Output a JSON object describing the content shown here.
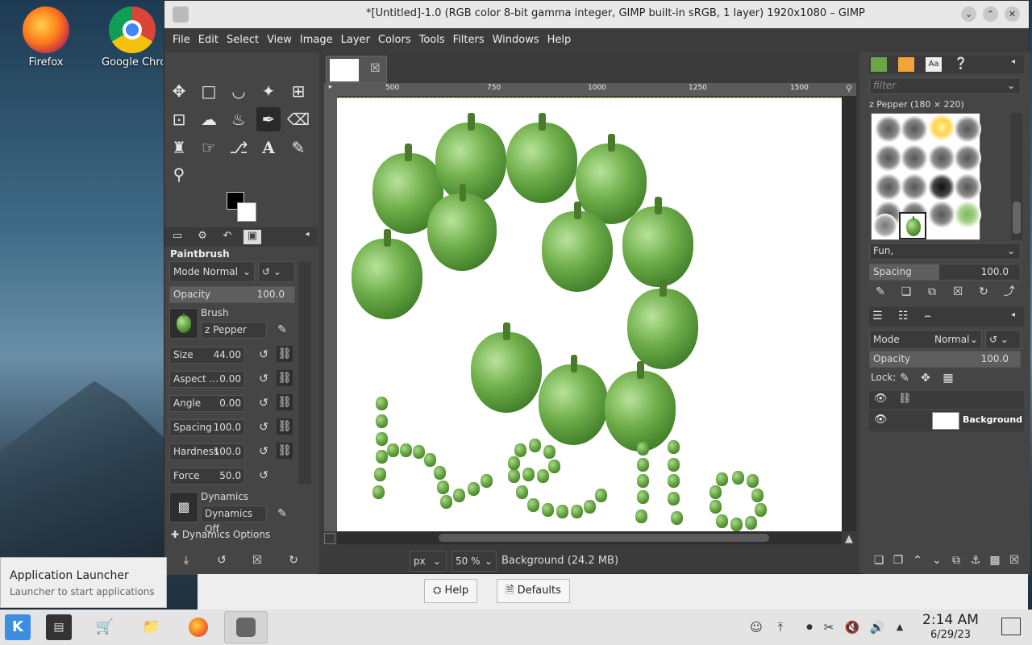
{
  "desktop": {
    "icons": [
      {
        "label": "Firefox",
        "icon": "firefox-icon"
      },
      {
        "label": "Google Chro",
        "icon": "chrome-icon"
      }
    ]
  },
  "window": {
    "title": "*[Untitled]-1.0 (RGB color 8-bit gamma integer, GIMP built-in sRGB, 1 layer) 1920x1080 – GIMP",
    "controls": [
      "minimize",
      "maximize",
      "close"
    ]
  },
  "menubar": [
    "File",
    "Edit",
    "Select",
    "View",
    "Image",
    "Layer",
    "Colors",
    "Tools",
    "Filters",
    "Windows",
    "Help"
  ],
  "tool_options": {
    "title": "Paintbrush",
    "mode_label": "Mode",
    "mode_value": "Normal",
    "opacity_label": "Opacity",
    "opacity_value": "100.0",
    "brush_label": "Brush",
    "brush_name": "z Pepper",
    "rows": [
      {
        "label": "Size",
        "value": "44.00"
      },
      {
        "label": "Aspect ...",
        "value": "0.00"
      },
      {
        "label": "Angle",
        "value": "0.00"
      },
      {
        "label": "Spacing",
        "value": "100.0"
      },
      {
        "label": "Hardness",
        "value": "100.0"
      },
      {
        "label": "Force",
        "value": "50.0"
      }
    ],
    "dynamics_label": "Dynamics",
    "dynamics_value": "Dynamics Off",
    "dynamics_options": "Dynamics Options"
  },
  "ruler": {
    "ticks": [
      "500",
      "750",
      "1000",
      "1250",
      "1500"
    ]
  },
  "statusbar": {
    "unit": "px",
    "zoom": "50 %",
    "info": "Background (24.2 MB)"
  },
  "brushes_panel": {
    "filter_placeholder": "filter",
    "selected_brush": "z Pepper (180 × 220)",
    "tag": "Fun,",
    "spacing_label": "Spacing",
    "spacing_value": "100.0"
  },
  "layers_panel": {
    "mode_label": "Mode",
    "mode_value": "Normal",
    "opacity_label": "Opacity",
    "opacity_value": "100.0",
    "lock_label": "Lock:",
    "layer_name": "Background"
  },
  "dialog": {
    "help": "Help",
    "defaults": "Defaults"
  },
  "tooltip": {
    "title": "Application Launcher",
    "subtitle": "Launcher to start applications"
  },
  "taskbar": {
    "time": "2:14 AM",
    "date": "6/29/23"
  }
}
